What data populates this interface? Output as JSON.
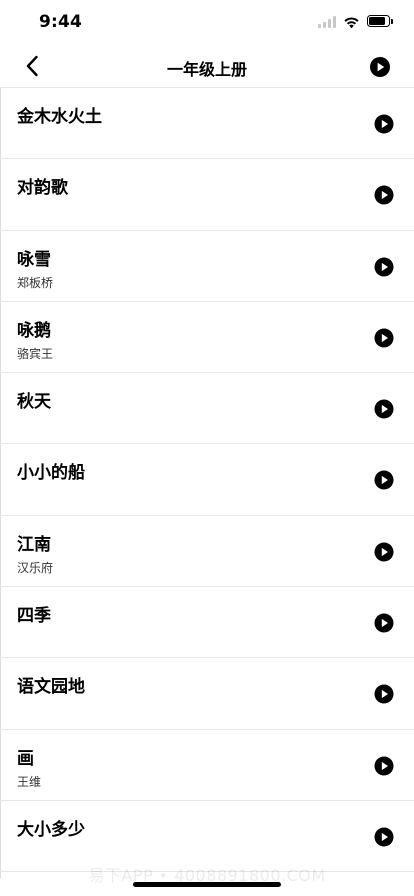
{
  "status_bar": {
    "time": "9:44"
  },
  "nav": {
    "title": "一年级上册"
  },
  "lessons": [
    {
      "title": "金木水火土",
      "author": ""
    },
    {
      "title": "对韵歌",
      "author": ""
    },
    {
      "title": "咏雪",
      "author": "郑板桥"
    },
    {
      "title": "咏鹅",
      "author": "骆宾王"
    },
    {
      "title": "秋天",
      "author": ""
    },
    {
      "title": "小小的船",
      "author": ""
    },
    {
      "title": "江南",
      "author": "汉乐府"
    },
    {
      "title": "四季",
      "author": ""
    },
    {
      "title": "语文园地",
      "author": ""
    },
    {
      "title": "画",
      "author": "王维"
    },
    {
      "title": "大小多少",
      "author": ""
    }
  ],
  "watermark": "易下APP • 4008891800.COM",
  "icons": {
    "back": "chevron-left-icon",
    "play": "play-circle-icon"
  },
  "colors": {
    "text": "#000000",
    "divider": "#e6e6e6",
    "background": "#ffffff"
  }
}
